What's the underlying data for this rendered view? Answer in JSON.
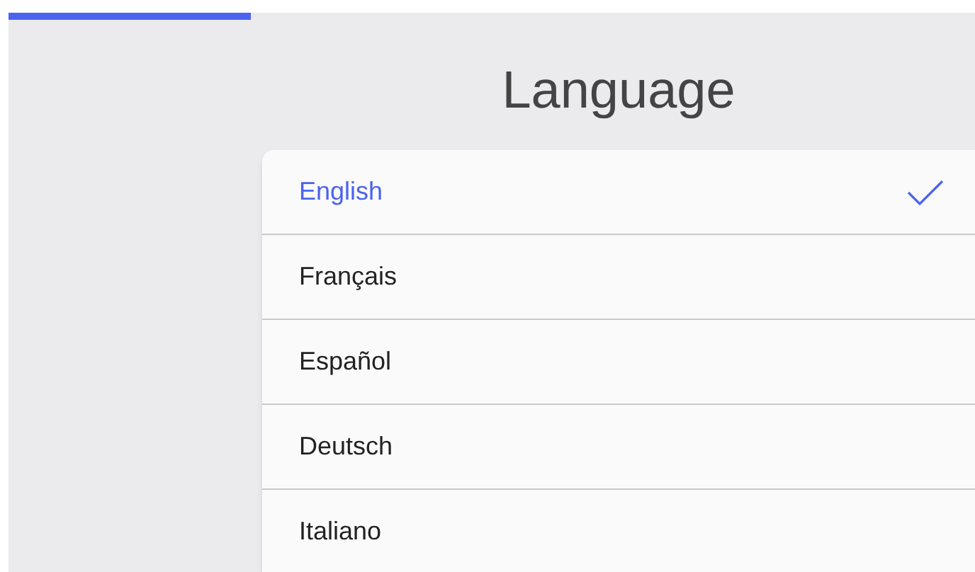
{
  "progress": {
    "level": 0.25
  },
  "title": "Language",
  "languages": [
    {
      "label": "English",
      "selected": true
    },
    {
      "label": "Français",
      "selected": false
    },
    {
      "label": "Español",
      "selected": false
    },
    {
      "label": "Deutsch",
      "selected": false
    },
    {
      "label": "Italiano",
      "selected": false
    }
  ]
}
